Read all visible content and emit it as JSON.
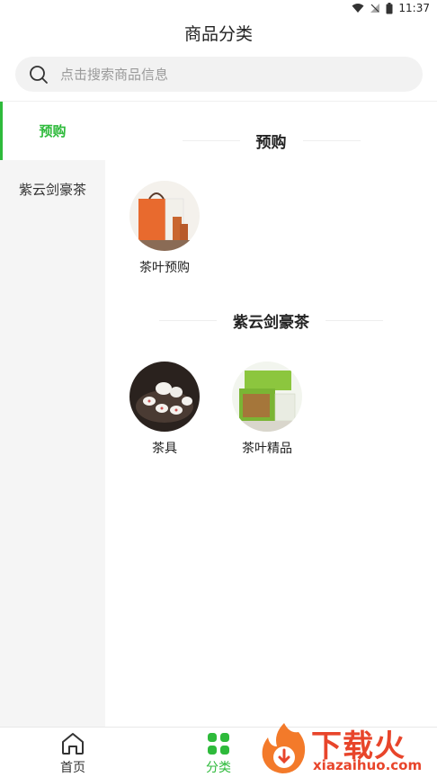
{
  "status_bar": {
    "time": "11:37"
  },
  "header": {
    "title": "商品分类"
  },
  "search": {
    "placeholder": "点击搜索商品信息",
    "value": ""
  },
  "sidebar": {
    "items": [
      {
        "label": "预购",
        "active": true
      },
      {
        "label": "紫云剑豪茶",
        "active": false
      }
    ]
  },
  "sections": [
    {
      "title": "预购",
      "items": [
        {
          "label": "茶叶预购"
        }
      ]
    },
    {
      "title": "紫云剑豪茶",
      "items": [
        {
          "label": "茶具"
        },
        {
          "label": "茶叶精品"
        }
      ]
    }
  ],
  "tabbar": {
    "items": [
      {
        "label": "首页",
        "icon": "home-icon",
        "active": false
      },
      {
        "label": "分类",
        "icon": "category-grid-icon",
        "active": true
      }
    ]
  },
  "watermark": {
    "text": "下载火",
    "sub": "xiazaihuo.com"
  },
  "colors": {
    "accent": "#2eba3b",
    "sidebar_bg": "#f5f5f5",
    "search_bg": "#f2f2f2",
    "watermark": "#e8452b"
  }
}
